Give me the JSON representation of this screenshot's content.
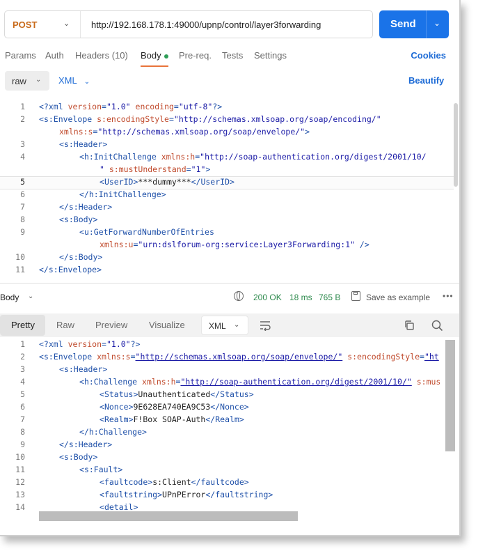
{
  "request": {
    "method": "POST",
    "url": "http://192.168.178.1:49000/upnp/control/layer3forwarding",
    "send_label": "Send"
  },
  "tabs": [
    {
      "label": "Params"
    },
    {
      "label": "Auth"
    },
    {
      "label": "Headers (10)"
    },
    {
      "label": "Body"
    },
    {
      "label": "Pre-req."
    },
    {
      "label": "Tests"
    },
    {
      "label": "Settings"
    }
  ],
  "cookies_label": "Cookies",
  "body_mode": "raw",
  "body_lang": "XML",
  "beautify_label": "Beautify",
  "request_body_line_numbers": [
    "1",
    "2",
    "3",
    "4",
    "5",
    "6",
    "7",
    "8",
    "9",
    "10",
    "11"
  ],
  "response": {
    "label": "Body",
    "status": "200 OK",
    "time": "18 ms",
    "size": "765 B",
    "save_label": "Save as example",
    "view_tabs": [
      "Pretty",
      "Raw",
      "Preview",
      "Visualize"
    ],
    "lang": "XML",
    "line_numbers": [
      "1",
      "2",
      "3",
      "4",
      "5",
      "6",
      "7",
      "8",
      "9",
      "10",
      "11",
      "12",
      "13",
      "14"
    ]
  },
  "colors": {
    "accent": "#1a73e8",
    "method": "#c86a1a",
    "status_ok": "#2e8a4d",
    "active_tab_underline": "#e8733a"
  },
  "icons": [
    "chevron-down-icon",
    "globe-icon",
    "save-icon",
    "more-icon",
    "wrap-icon",
    "copy-icon",
    "search-icon"
  ]
}
